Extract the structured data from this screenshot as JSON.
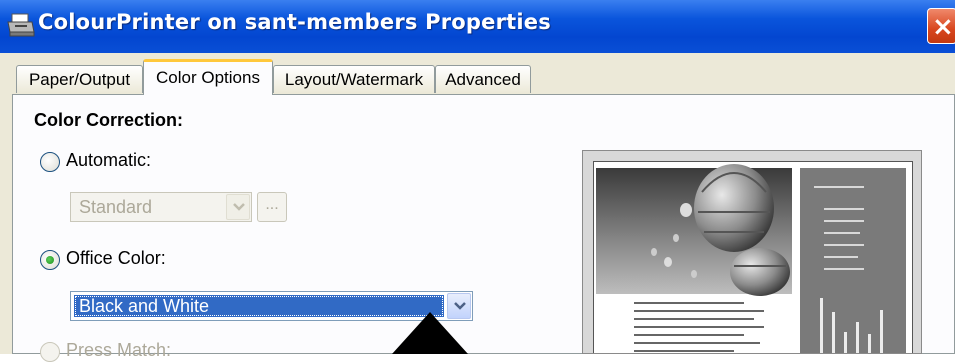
{
  "window": {
    "title": "ColourPrinter on sant-members Properties",
    "icon": "printer-icon",
    "close_label": "×"
  },
  "tabs": [
    {
      "label": "Paper/Output",
      "active": false
    },
    {
      "label": "Color Options",
      "active": true
    },
    {
      "label": "Layout/Watermark",
      "active": false
    },
    {
      "label": "Advanced",
      "active": false
    }
  ],
  "color_correction": {
    "heading": "Color Correction:",
    "automatic": {
      "label": "Automatic:",
      "selected": false,
      "combo_value": "Standard",
      "ellipsis_label": "..."
    },
    "office_color": {
      "label": "Office Color:",
      "selected": true,
      "combo_value": "Black and White"
    },
    "press_match": {
      "label": "Press Match:",
      "selected": false,
      "enabled": false
    }
  },
  "preview": {
    "description_icon": "page-preview-icon"
  },
  "colors": {
    "titlebar": "#0a55dc",
    "dialog_bg": "#ece9d8",
    "selection": "#316ac5",
    "active_tab_accent": "#ffc83c"
  }
}
